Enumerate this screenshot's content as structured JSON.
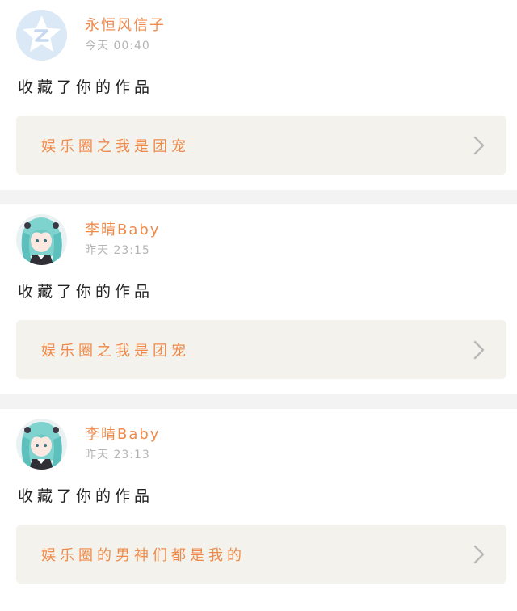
{
  "notifications": [
    {
      "avatar": "qzone-star-avatar",
      "username": "永恒风信子",
      "time": "今天 00:40",
      "action": "收藏了你的作品",
      "work_title": "娱乐圈之我是团宠",
      "chevron": "chevron-right-icon"
    },
    {
      "avatar": "anime-girl-avatar",
      "username": "李晴Baby",
      "time": "昨天 23:15",
      "action": "收藏了你的作品",
      "work_title": "娱乐圈之我是团宠",
      "chevron": "chevron-right-icon"
    },
    {
      "avatar": "anime-girl-avatar",
      "username": "李晴Baby",
      "time": "昨天 23:13",
      "action": "收藏了你的作品",
      "work_title": "娱乐圈的男神们都是我的",
      "chevron": "chevron-right-icon"
    }
  ],
  "colors": {
    "username": "#f08a4b",
    "time": "#b4b4b4",
    "action": "#222222",
    "work_box_bg": "#f3f2ec",
    "separator": "#f3f3f3"
  }
}
